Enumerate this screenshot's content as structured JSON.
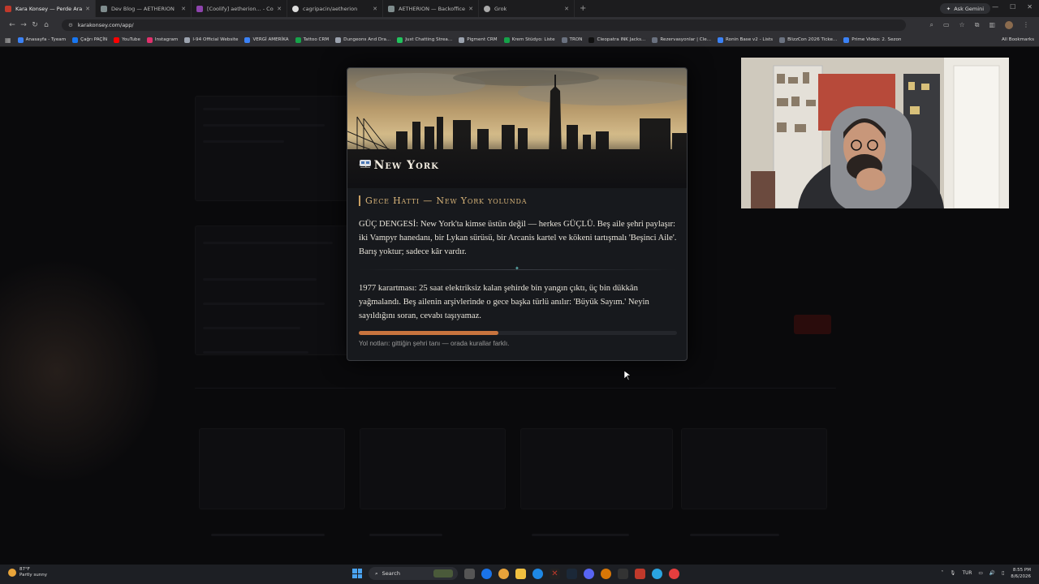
{
  "browser": {
    "tabs": [
      {
        "title": "Kara Konsey — Perde Arakası",
        "active": true,
        "color": "#c0392b"
      },
      {
        "title": "Dev Blog — AETHERION",
        "active": false,
        "color": "#7f8c8d"
      },
      {
        "title": "[Coolify] aetherion... - Configu",
        "active": false,
        "color": "#8e44ad"
      },
      {
        "title": "cagripacin/aetherion",
        "active": false,
        "color": "#dddddd"
      },
      {
        "title": "AETHERION — Backoffice",
        "active": false,
        "color": "#7f8c8d"
      },
      {
        "title": "Grok",
        "active": false,
        "color": "#aaaaaa"
      }
    ],
    "new_tab": "+",
    "gemini_label": "Ask Gemini",
    "url": "karakonsey.com/app/",
    "bookmarks": [
      {
        "label": "Anasayfa - Tyeam",
        "color": "#3b82f6"
      },
      {
        "label": "Çağrı PAÇİN",
        "color": "#1877f2"
      },
      {
        "label": "YouTube",
        "color": "#ff0000"
      },
      {
        "label": "Instagram",
        "color": "#e1306c"
      },
      {
        "label": "I-94 Official Website",
        "color": "#9ca3af"
      },
      {
        "label": "VERGİ AMERİKA",
        "color": "#3b82f6"
      },
      {
        "label": "Tattoo CRM",
        "color": "#16a34a"
      },
      {
        "label": "Dungeons And Dra...",
        "color": "#9ca3af"
      },
      {
        "label": "Just Chatting Strea...",
        "color": "#22c55e"
      },
      {
        "label": "Pigment CRM",
        "color": "#9ca3af"
      },
      {
        "label": "Krem Stüdyo: Liste",
        "color": "#16a34a"
      },
      {
        "label": "TRON",
        "color": "#6b7280"
      },
      {
        "label": "Cleopatra INK Jacks...",
        "color": "#111111"
      },
      {
        "label": "Rezervasyonlar | Cle...",
        "color": "#6b7280"
      },
      {
        "label": "Ronin Base v2 - Lists",
        "color": "#3b82f6"
      },
      {
        "label": "BlizzCon 2026 Ticke...",
        "color": "#6b7280"
      },
      {
        "label": "Prime Video: 2. Sezon",
        "color": "#3b82f6"
      }
    ],
    "all_bookmarks": "All Bookmarks"
  },
  "modal": {
    "title": "→ New York",
    "train_icon": "train-icon",
    "section_title": "Gece Hattı — New York yolunda",
    "paragraph1": "GÜÇ DENGESİ: New York'ta kimse üstün değil — herkes GÜÇLÜ. Beş aile şehri paylaşır: iki Vampyr hanedanı, bir Lykan sürüsü, bir Arcanis kartel ve kökeni tartışmalı 'Beşinci Aile'. Barış yoktur; sadece kâr vardır.",
    "divider_glyph": "✦",
    "paragraph2": "1977 karartması: 25 saat elektriksiz kalan şehirde bin yangın çıktı, üç bin dükkân yağmalandı. Beş ailenin arşivlerinde o gece başka türlü anılır: 'Büyük Sayım.' Neyin sayıldığını soran, cevabı taşıyamaz.",
    "progress": 0.44,
    "progress_color": "#c8743e",
    "notes": "Yol notları: gittiğin şehri tanı — orada kurallar farklı."
  },
  "taskbar": {
    "weather_temp": "87°F",
    "weather_desc": "Partly sunny",
    "search_label": "Search",
    "language": "TUR",
    "time": "8:55 PM",
    "date": "8/6/2026"
  }
}
